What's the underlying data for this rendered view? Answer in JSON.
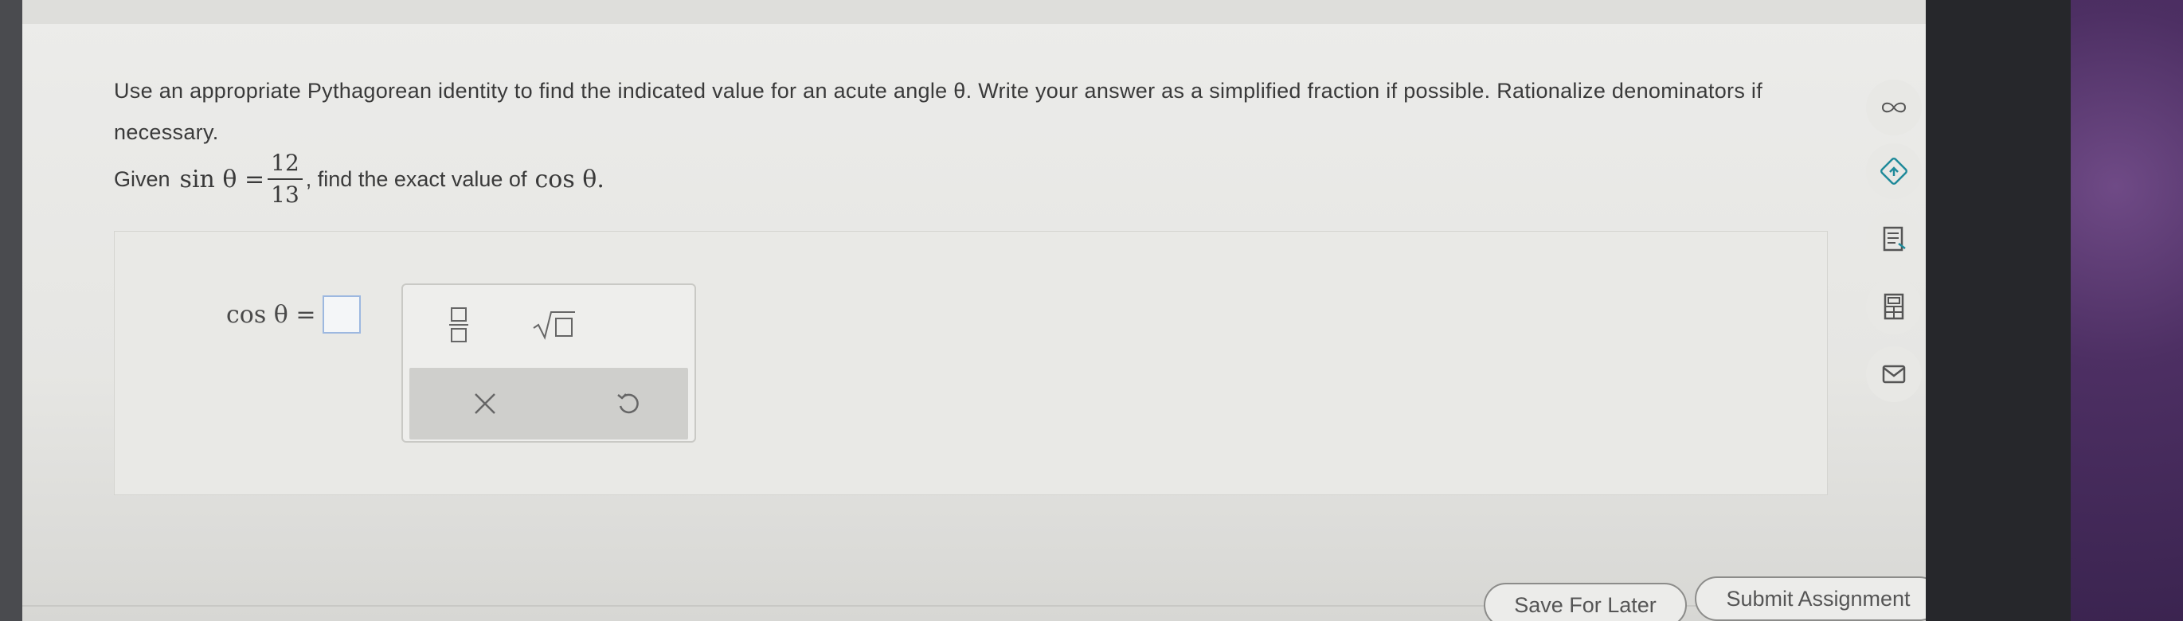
{
  "question": {
    "instructions": "Use an appropriate Pythagorean identity to find the indicated value for an acute angle θ. Write your answer as a simplified fraction if possible. Rationalize denominators if necessary.",
    "given_prefix": "Given",
    "given_lhs": "sin θ =",
    "given_numerator": "12",
    "given_denominator": "13",
    "given_suffix": ", find the exact value of",
    "target": "cos θ."
  },
  "answer": {
    "label": "cos θ ="
  },
  "palette": {
    "fraction_icon": "fraction-icon",
    "sqrt_icon": "square-root-icon",
    "clear_icon": "clear-icon",
    "undo_icon": "undo-icon"
  },
  "tools": [
    "infinity-icon",
    "hint-icon",
    "textbook-icon",
    "calculator-icon",
    "message-icon"
  ],
  "footer": {
    "save_label": "Save For Later",
    "submit_label": "Submit Assignment"
  }
}
